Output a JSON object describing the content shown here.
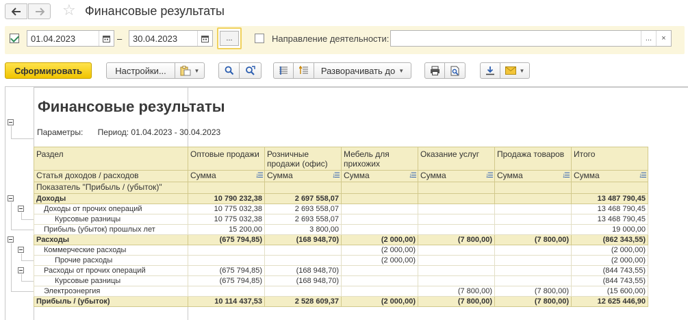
{
  "window": {
    "title": "Финансовые результаты"
  },
  "icons": {
    "back": "arrow-left-icon",
    "forward": "arrow-right-icon",
    "favorite": "star-icon",
    "calendar": "calendar-icon"
  },
  "filters": {
    "period_checked": true,
    "date_from": "01.04.2023",
    "dash": "–",
    "date_to": "30.04.2023",
    "period_btn": "...",
    "direction_checked": false,
    "direction_label": "Направление деятельности:",
    "direction_value": "",
    "select_btn": "...",
    "clear_btn": "×"
  },
  "toolbar": {
    "generate": "Сформировать",
    "settings": "Настройки...",
    "expand_to": "Разворачивать до"
  },
  "report": {
    "title": "Финансовые результаты",
    "params_label": "Параметры:",
    "params_value": "Период: 01.04.2023 - 30.04.2023",
    "header": {
      "col0_row1": "Раздел",
      "col0_row2": "Статья доходов / расходов",
      "col0_row3": "Показатель \"Прибыль / (убыток)\"",
      "columns": [
        "Оптовые продажи",
        "Розничные продажи (офис)",
        "Мебель для прихожих",
        "Оказание услуг",
        "Продажа товаров",
        "Итого"
      ],
      "sum_label": "Сумма"
    },
    "rows": [
      {
        "name": "Доходы",
        "level": 0,
        "group": true,
        "values": [
          "10 790 232,38",
          "2 697 558,07",
          "",
          "",
          "",
          "13 487 790,45"
        ]
      },
      {
        "name": "Доходы от прочих операций",
        "level": 1,
        "group": false,
        "values": [
          "10 775 032,38",
          "2 693 558,07",
          "",
          "",
          "",
          "13 468 790,45"
        ]
      },
      {
        "name": "Курсовые разницы",
        "level": 2,
        "group": false,
        "values": [
          "10 775 032,38",
          "2 693 558,07",
          "",
          "",
          "",
          "13 468 790,45"
        ]
      },
      {
        "name": "Прибыль (убыток) прошлых лет",
        "level": 1,
        "group": false,
        "values": [
          "15 200,00",
          "3 800,00",
          "",
          "",
          "",
          "19 000,00"
        ]
      },
      {
        "name": "Расходы",
        "level": 0,
        "group": true,
        "values": [
          "(675 794,85)",
          "(168 948,70)",
          "(2 000,00)",
          "(7 800,00)",
          "(7 800,00)",
          "(862 343,55)"
        ]
      },
      {
        "name": "Коммерческие расходы",
        "level": 1,
        "group": false,
        "values": [
          "",
          "",
          "(2 000,00)",
          "",
          "",
          "(2 000,00)"
        ]
      },
      {
        "name": "Прочие расходы",
        "level": 2,
        "group": false,
        "values": [
          "",
          "",
          "(2 000,00)",
          "",
          "",
          "(2 000,00)"
        ]
      },
      {
        "name": "Расходы от прочих операций",
        "level": 1,
        "group": false,
        "values": [
          "(675 794,85)",
          "(168 948,70)",
          "",
          "",
          "",
          "(844 743,55)"
        ]
      },
      {
        "name": "Курсовые разницы",
        "level": 2,
        "group": false,
        "values": [
          "(675 794,85)",
          "(168 948,70)",
          "",
          "",
          "",
          "(844 743,55)"
        ]
      },
      {
        "name": "Электроэнергия",
        "level": 1,
        "group": false,
        "values": [
          "",
          "",
          "",
          "(7 800,00)",
          "(7 800,00)",
          "(15 600,00)"
        ]
      },
      {
        "name": "Прибыль / (убыток)",
        "level": 0,
        "group": true,
        "values": [
          "10 114 437,53",
          "2 528 609,37",
          "(2 000,00)",
          "(7 800,00)",
          "(7 800,00)",
          "12 625 446,90"
        ]
      }
    ]
  }
}
